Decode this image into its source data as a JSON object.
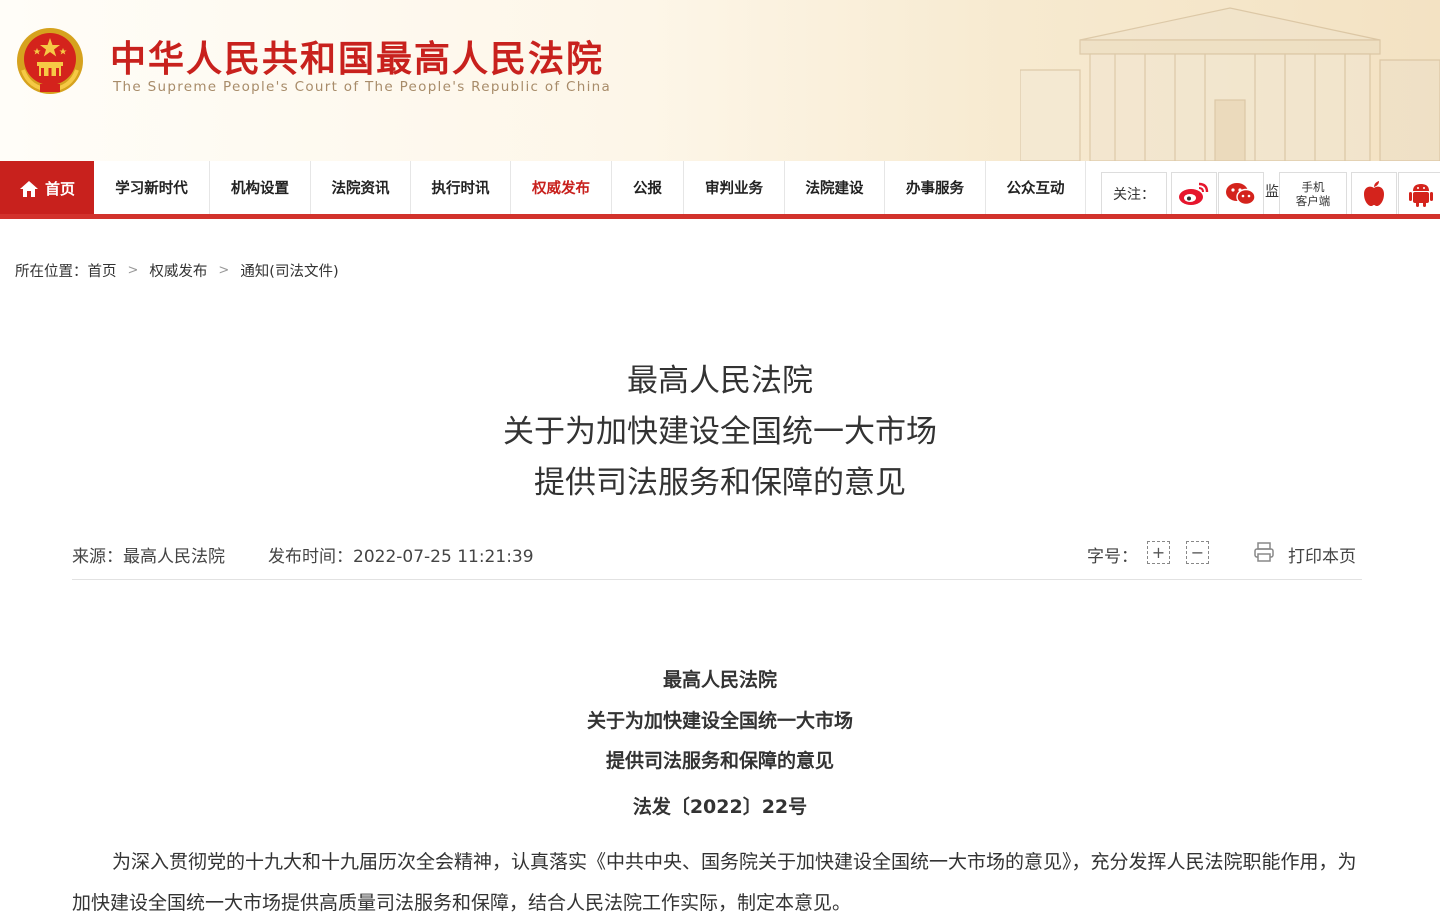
{
  "header": {
    "title": "中华人民共和国最高人民法院",
    "subtitle": "The Supreme People's Court of The People's Republic of China"
  },
  "nav": {
    "home": "首页",
    "items": [
      "学习新时代",
      "机构设置",
      "法院资讯",
      "执行时讯",
      "权威发布",
      "公报",
      "审判业务",
      "法院建设",
      "办事服务",
      "公众互动"
    ],
    "active_index": 4,
    "follow_label": "关注：",
    "mobile_line1": "手机",
    "mobile_line2": "客户端"
  },
  "breadcrumb": {
    "prefix": "所在位置：",
    "items": [
      "首页",
      "权威发布",
      "通知(司法文件)"
    ],
    "separator": ">"
  },
  "article": {
    "title_lines": [
      "最高人民法院",
      "关于为加快建设全国统一大市场",
      "提供司法服务和保障的意见"
    ],
    "source": "来源：最高人民法院",
    "publish_time": "发布时间：2022-07-25 11:21:39",
    "font_size_label": "字号：",
    "font_increase": "+",
    "font_decrease": "−",
    "print_label": "打印本页",
    "heading_lines": [
      "最高人民法院",
      "关于为加快建设全国统一大市场",
      "提供司法服务和保障的意见"
    ],
    "doc_number": "法发〔2022〕22号",
    "paragraph": "为深入贯彻党的十九大和十九届历次全会精神，认真落实《中共中央、国务院关于加快建设全国统一大市场的意见》，充分发挥人民法院职能作用，为加快建设全国统一大市场提供高质量司法服务和保障，结合人民法院工作实际，制定本意见。"
  },
  "colors": {
    "brand_red": "#c8211d",
    "nav_line": "#d2322c"
  }
}
